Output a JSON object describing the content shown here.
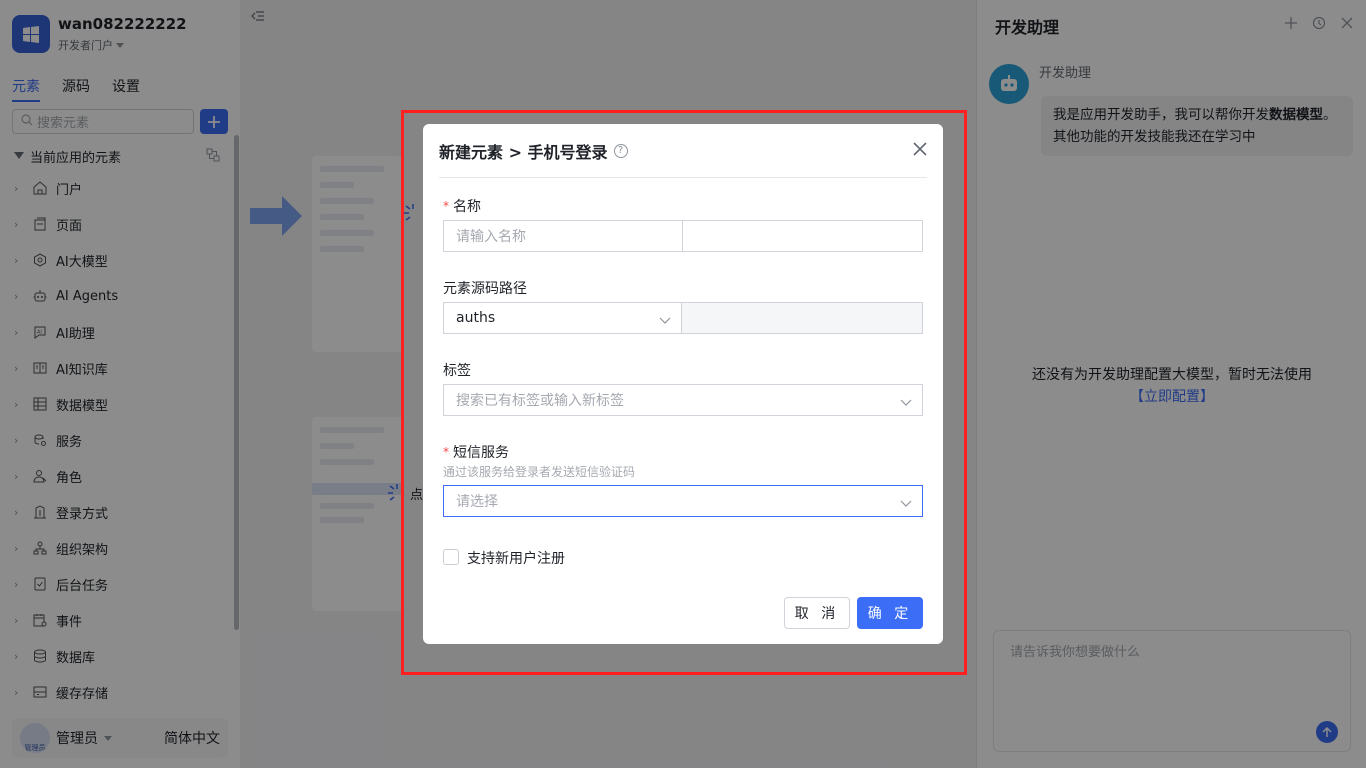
{
  "app": {
    "name": "wan082222222",
    "portal": "开发者门户"
  },
  "tabs": [
    {
      "label": "元素",
      "active": true
    },
    {
      "label": "源码",
      "active": false
    },
    {
      "label": "设置",
      "active": false
    }
  ],
  "search": {
    "placeholder": "搜索元素"
  },
  "tree": {
    "header": "当前应用的元素",
    "items": [
      {
        "label": "门户",
        "icon": "home-icon"
      },
      {
        "label": "页面",
        "icon": "page-icon"
      },
      {
        "label": "AI大模型",
        "icon": "ai-model-icon"
      },
      {
        "label": "AI Agents",
        "icon": "robot-icon"
      },
      {
        "label": "AI助理",
        "icon": "ai-assistant-icon"
      },
      {
        "label": "AI知识库",
        "icon": "book-icon"
      },
      {
        "label": "数据模型",
        "icon": "table-icon"
      },
      {
        "label": "服务",
        "icon": "service-icon"
      },
      {
        "label": "角色",
        "icon": "role-icon"
      },
      {
        "label": "登录方式",
        "icon": "login-icon"
      },
      {
        "label": "组织架构",
        "icon": "org-icon"
      },
      {
        "label": "后台任务",
        "icon": "task-icon"
      },
      {
        "label": "事件",
        "icon": "event-icon"
      },
      {
        "label": "数据库",
        "icon": "database-icon"
      },
      {
        "label": "缓存存储",
        "icon": "cache-icon"
      }
    ]
  },
  "footer": {
    "user": "管理员",
    "avatar_text": "管理员",
    "language": "简体中文"
  },
  "canvas": {
    "hint_char": "点"
  },
  "assistant": {
    "title": "开发助理",
    "bot_name": "开发助理",
    "greeting_prefix": "我是应用开发助手，我可以帮你开发",
    "greeting_bold": "数据模型",
    "greeting_suffix": "。其他功能的开发技能我还在学习中",
    "empty_tip": "还没有为开发助理配置大模型，暂时无法使用",
    "empty_link": "【立即配置】",
    "input_placeholder": "请告诉我你想要做什么"
  },
  "modal": {
    "title": "新建元素 > 手机号登录",
    "name": {
      "label": "名称",
      "placeholder": "请输入名称",
      "value2": ""
    },
    "path": {
      "label": "元素源码路径",
      "value": "auths",
      "value2": ""
    },
    "tags": {
      "label": "标签",
      "placeholder": "搜索已有标签或输入新标签"
    },
    "sms": {
      "label": "短信服务",
      "hint": "通过该服务给登录者发送短信验证码",
      "placeholder": "请选择"
    },
    "register": {
      "label": "支持新用户注册",
      "checked": false
    },
    "cancel": "取 消",
    "ok": "确 定"
  },
  "colors": {
    "accent": "#3b6df6",
    "required": "#f54a45",
    "highlight": "#ff1f1f"
  }
}
